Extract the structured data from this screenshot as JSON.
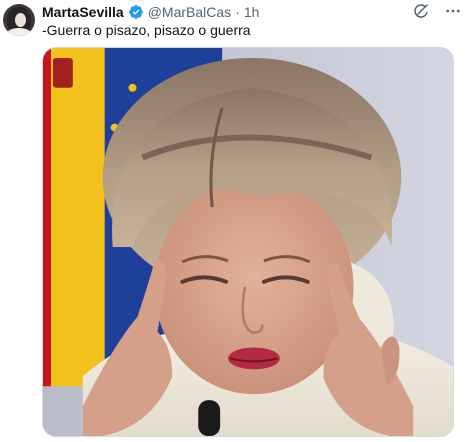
{
  "tweet": {
    "display_name": "MartaSevilla",
    "handle": "@MarBalCas",
    "separator": "·",
    "time": "1h",
    "text": "-Guerra o pisazo, pisazo o guerra",
    "verified_color": "#1d9bf0"
  },
  "icons": {
    "verified": "verified-badge-icon",
    "grok": "grok-icon",
    "more": "more-icon"
  }
}
